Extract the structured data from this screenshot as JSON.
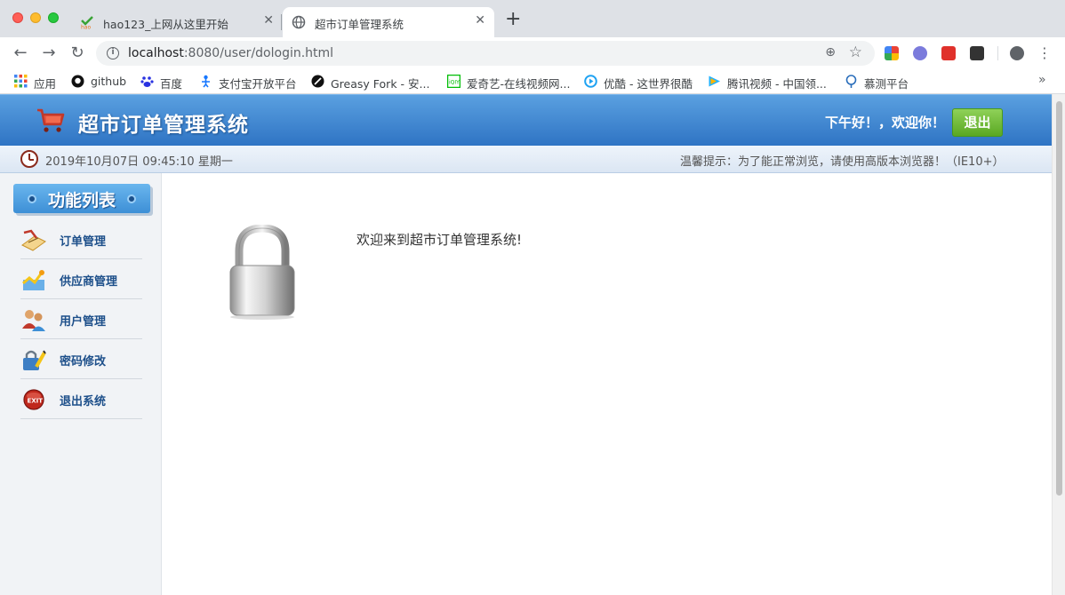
{
  "browser": {
    "tabs": [
      {
        "title": "hao123_上网从这里开始",
        "active": false,
        "icon": "hao123-icon"
      },
      {
        "title": "超市订单管理系统",
        "active": true,
        "icon": "globe-icon"
      }
    ],
    "url_host": "localhost",
    "url_path": ":8080/user/dologin.html",
    "bookmarks": [
      {
        "label": "应用",
        "icon": "apps-grid-icon"
      },
      {
        "label": "github",
        "icon": "github-icon"
      },
      {
        "label": "百度",
        "icon": "baidu-icon"
      },
      {
        "label": "支付宝开放平台",
        "icon": "alipay-icon"
      },
      {
        "label": "Greasy Fork - 安...",
        "icon": "greasyfork-icon"
      },
      {
        "label": "爱奇艺-在线视频网...",
        "icon": "iqiyi-icon"
      },
      {
        "label": "优酷 - 这世界很酷",
        "icon": "youku-icon"
      },
      {
        "label": "腾讯视频 - 中国领...",
        "icon": "tencent-video-icon"
      },
      {
        "label": "慕测平台",
        "icon": "mooctest-icon"
      }
    ]
  },
  "header": {
    "title": "超市订单管理系统",
    "greeting": "下午好！，欢迎你！",
    "logout_label": "退出"
  },
  "infobar": {
    "datetime": "2019年10月07日 09:45:10 星期一",
    "tip": "温馨提示：为了能正常浏览，请使用高版本浏览器！（IE10+）"
  },
  "sidebar": {
    "title": "功能列表",
    "items": [
      {
        "label": "订单管理",
        "icon": "order-icon"
      },
      {
        "label": "供应商管理",
        "icon": "supplier-icon"
      },
      {
        "label": "用户管理",
        "icon": "users-icon"
      },
      {
        "label": "密码修改",
        "icon": "password-icon"
      },
      {
        "label": "退出系统",
        "icon": "exit-icon"
      }
    ]
  },
  "main": {
    "welcome": "欢迎来到超市订单管理系统!",
    "icon": "lock-icon"
  },
  "colors": {
    "header_blue": "#2f74c4",
    "logout_green": "#5aa823",
    "menu_text": "#1d4f8a"
  }
}
